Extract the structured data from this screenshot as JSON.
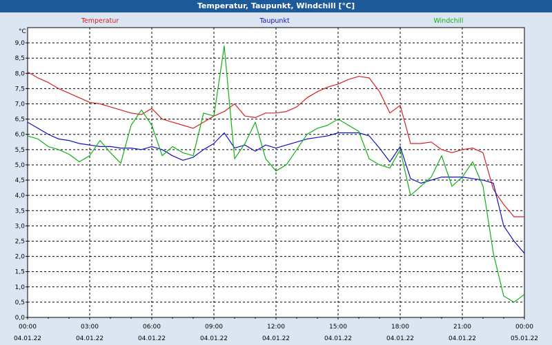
{
  "window": {
    "title": "Temperatur, Taupunkt, Windchill [°C]"
  },
  "chart_data": {
    "type": "line",
    "title": "Temperatur, Taupunkt, Windchill [°C]",
    "ylabel": "°C",
    "ylim": [
      0,
      9.5
    ],
    "y_ticks": [
      "0,0",
      "0,5",
      "1,0",
      "1,5",
      "2,0",
      "2,5",
      "3,0",
      "3,5",
      "4,0",
      "4,5",
      "5,0",
      "5,5",
      "6,0",
      "6,5",
      "7,0",
      "7,5",
      "8,0",
      "8,5",
      "9,0"
    ],
    "x_ticks": [
      {
        "time": "00:00",
        "date": "04.01.22"
      },
      {
        "time": "03:00",
        "date": "04.01.22"
      },
      {
        "time": "06:00",
        "date": "04.01.22"
      },
      {
        "time": "09:00",
        "date": "04.01.22"
      },
      {
        "time": "12:00",
        "date": "04.01.22"
      },
      {
        "time": "15:00",
        "date": "04.01.22"
      },
      {
        "time": "18:00",
        "date": "04.01.22"
      },
      {
        "time": "21:00",
        "date": "04.01.22"
      },
      {
        "time": "00:00",
        "date": "05.01.22"
      }
    ],
    "xlim_hours": [
      0,
      24
    ],
    "grid": true,
    "legend_position": "top",
    "series": [
      {
        "name": "Temperatur",
        "color": "#d42020",
        "x": [
          0,
          0.5,
          1,
          1.5,
          2,
          2.5,
          3,
          3.5,
          4,
          4.5,
          5,
          5.5,
          6,
          6.5,
          7,
          7.5,
          8,
          8.5,
          9,
          9.5,
          10,
          10.5,
          11,
          11.5,
          12,
          12.5,
          13,
          13.5,
          14,
          14.5,
          15,
          15.5,
          16,
          16.5,
          17,
          17.5,
          18,
          18.5,
          19,
          19.5,
          20,
          20.5,
          21,
          21.5,
          22,
          22.5,
          23,
          23.5,
          24
        ],
        "values": [
          8.05,
          7.85,
          7.7,
          7.5,
          7.35,
          7.2,
          7.05,
          7.0,
          6.9,
          6.8,
          6.7,
          6.65,
          6.85,
          6.5,
          6.4,
          6.3,
          6.2,
          6.4,
          6.6,
          6.75,
          7.0,
          6.6,
          6.55,
          6.7,
          6.7,
          6.75,
          6.9,
          7.2,
          7.4,
          7.55,
          7.65,
          7.8,
          7.9,
          7.85,
          7.4,
          6.7,
          6.95,
          5.7,
          5.7,
          5.75,
          5.5,
          5.4,
          5.5,
          5.55,
          5.4,
          4.2,
          3.7,
          3.3,
          3.3
        ]
      },
      {
        "name": "Taupunkt",
        "color": "#1010c8",
        "x": [
          0,
          0.5,
          1,
          1.5,
          2,
          2.5,
          3,
          3.5,
          4,
          4.5,
          5,
          5.5,
          6,
          6.5,
          7,
          7.5,
          8,
          8.5,
          9,
          9.5,
          10,
          10.5,
          11,
          11.5,
          12,
          12.5,
          13,
          13.5,
          14,
          14.5,
          15,
          15.5,
          16,
          16.5,
          17,
          17.5,
          18,
          18.5,
          19,
          19.5,
          20,
          20.5,
          21,
          21.5,
          22,
          22.5,
          23,
          23.5,
          24
        ],
        "values": [
          6.4,
          6.2,
          6.0,
          5.85,
          5.8,
          5.7,
          5.65,
          5.6,
          5.6,
          5.55,
          5.55,
          5.5,
          5.6,
          5.5,
          5.3,
          5.15,
          5.25,
          5.5,
          5.7,
          6.05,
          5.55,
          5.65,
          5.45,
          5.65,
          5.55,
          5.65,
          5.75,
          5.85,
          5.9,
          5.95,
          6.05,
          6.05,
          6.05,
          5.95,
          5.55,
          5.1,
          5.6,
          4.55,
          4.4,
          4.5,
          4.6,
          4.6,
          4.6,
          4.55,
          4.5,
          4.4,
          3.0,
          2.5,
          2.1
        ]
      },
      {
        "name": "Windchill",
        "color": "#10b010",
        "x": [
          0,
          0.5,
          1,
          1.5,
          2,
          2.5,
          3,
          3.5,
          4,
          4.5,
          5,
          5.5,
          6,
          6.5,
          7,
          7.5,
          8,
          8.5,
          9,
          9.5,
          10,
          10.5,
          11,
          11.5,
          12,
          12.5,
          13,
          13.5,
          14,
          14.5,
          15,
          15.5,
          16,
          16.5,
          17,
          17.5,
          18,
          18.5,
          19,
          19.5,
          20,
          20.5,
          21,
          21.5,
          22,
          22.5,
          23,
          23.5,
          24
        ],
        "values": [
          5.95,
          5.85,
          5.6,
          5.5,
          5.35,
          5.1,
          5.3,
          5.8,
          5.4,
          5.05,
          6.3,
          6.8,
          6.3,
          5.3,
          5.6,
          5.4,
          5.3,
          6.7,
          6.6,
          8.9,
          5.2,
          5.7,
          6.4,
          5.2,
          4.8,
          5.0,
          5.5,
          6.0,
          6.2,
          6.3,
          6.5,
          6.3,
          6.1,
          5.2,
          5.0,
          4.9,
          5.5,
          4.0,
          4.3,
          4.6,
          5.3,
          4.3,
          4.6,
          5.1,
          4.3,
          2.1,
          0.7,
          0.5,
          0.75
        ]
      }
    ]
  }
}
